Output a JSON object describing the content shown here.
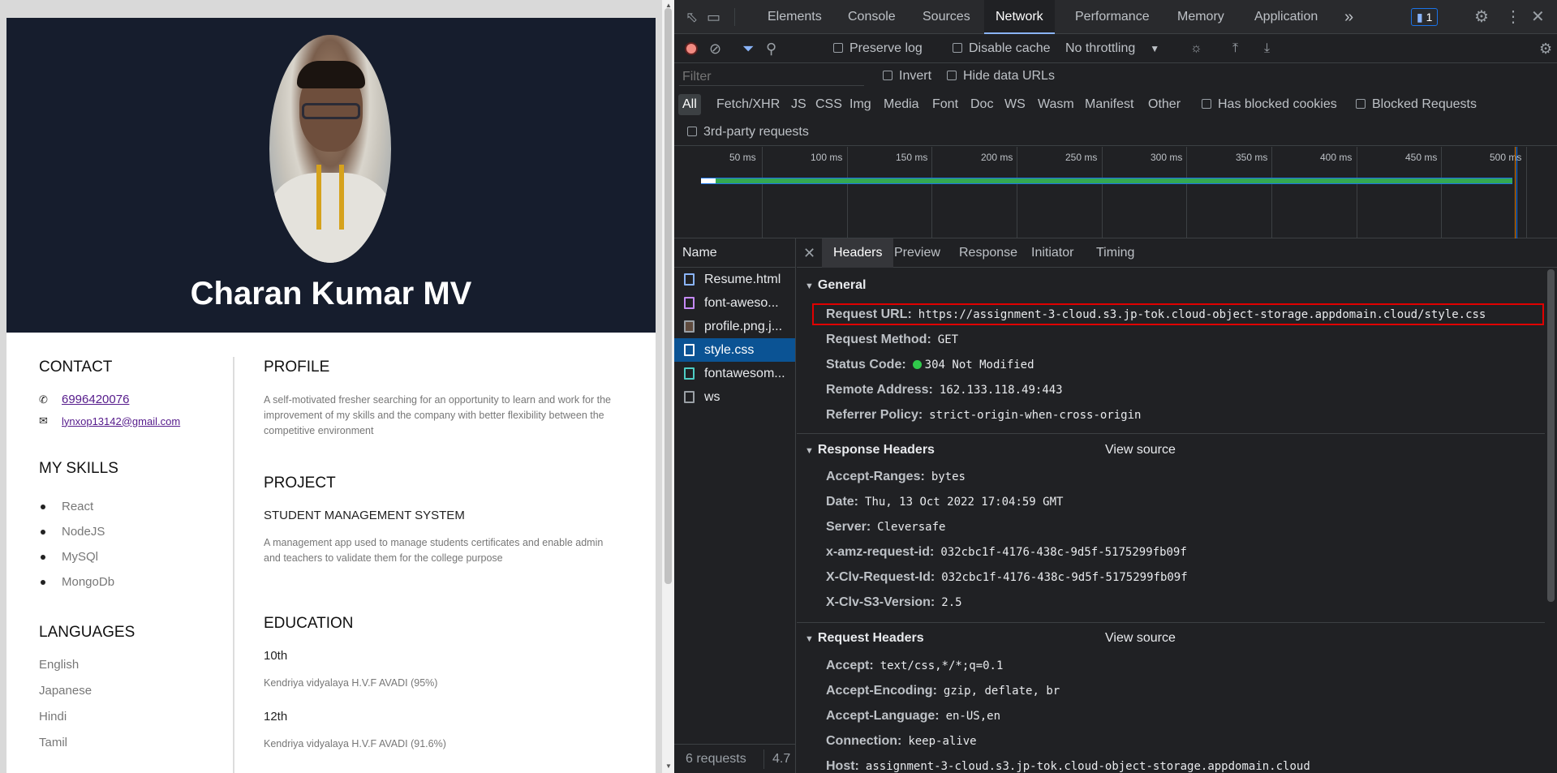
{
  "resume": {
    "name": "Charan Kumar MV",
    "contact": {
      "heading": "CONTACT",
      "phone": "6996420076",
      "email": "lynxop13142@gmail.com"
    },
    "skills": {
      "heading": "MY SKILLS",
      "items": [
        "React",
        "NodeJS",
        "MySQl",
        "MongoDb"
      ]
    },
    "languages": {
      "heading": "LANGUAGES",
      "items": [
        "English",
        "Japanese",
        "Hindi",
        "Tamil"
      ]
    },
    "profile": {
      "heading": "PROFILE",
      "text": "A self-motivated fresher searching for an opportunity to learn and work for the improvement of my skills and the company with better flexibility between the competitive environment"
    },
    "project": {
      "heading": "PROJECT",
      "title": "STUDENT MANAGEMENT SYSTEM",
      "text": "A management app used to manage students certificates and enable admin and teachers to validate them for the college purpose"
    },
    "education": {
      "heading": "EDUCATION",
      "items": [
        {
          "level": "10th",
          "school": "Kendriya vidyalaya H.V.F AVADI (95%)"
        },
        {
          "level": "12th",
          "school": "Kendriya vidyalaya H.V.F AVADI (91.6%)"
        }
      ]
    }
  },
  "devtools": {
    "tabs": [
      "Elements",
      "Console",
      "Sources",
      "Network",
      "Performance",
      "Memory",
      "Application"
    ],
    "active_tab": "Network",
    "more_tabs": "»",
    "issues_count": "1",
    "toolbar": {
      "preserve_log": "Preserve log",
      "disable_cache": "Disable cache",
      "throttling": "No throttling"
    },
    "filter": {
      "placeholder": "Filter",
      "invert": "Invert",
      "hide_data_urls": "Hide data URLs"
    },
    "types": [
      "All",
      "Fetch/XHR",
      "JS",
      "CSS",
      "Img",
      "Media",
      "Font",
      "Doc",
      "WS",
      "Wasm",
      "Manifest",
      "Other"
    ],
    "has_blocked_cookies": "Has blocked cookies",
    "blocked_requests": "Blocked Requests",
    "third_party": "3rd-party requests",
    "timeline_ticks": [
      "50 ms",
      "100 ms",
      "150 ms",
      "200 ms",
      "250 ms",
      "300 ms",
      "350 ms",
      "400 ms",
      "450 ms",
      "500 ms"
    ],
    "name_header": "Name",
    "files": [
      {
        "name": "Resume.html",
        "icon": "document-icon",
        "color": "#8ab4f8"
      },
      {
        "name": "font-aweso...",
        "icon": "stylesheet-icon",
        "color": "#c58af9"
      },
      {
        "name": "profile.png.j...",
        "icon": "image-icon",
        "color": "#9aa0a6"
      },
      {
        "name": "style.css",
        "icon": "stylesheet-icon",
        "color": "#ffffff"
      },
      {
        "name": "fontawesom...",
        "icon": "font-icon",
        "color": "#4ecdc4"
      },
      {
        "name": "ws",
        "icon": "websocket-icon",
        "color": "#9aa0a6"
      }
    ],
    "selected_file": "style.css",
    "footer": {
      "requests": "6 requests",
      "size": "4.7"
    },
    "detail_tabs": [
      "Headers",
      "Preview",
      "Response",
      "Initiator",
      "Timing"
    ],
    "active_detail_tab": "Headers",
    "general": {
      "title": "General",
      "rows": [
        {
          "k": "Request URL:",
          "v": "https://assignment-3-cloud.s3.jp-tok.cloud-object-storage.appdomain.cloud/style.css"
        },
        {
          "k": "Request Method:",
          "v": "GET"
        },
        {
          "k": "Status Code:",
          "v": "304 Not Modified"
        },
        {
          "k": "Remote Address:",
          "v": "162.133.118.49:443"
        },
        {
          "k": "Referrer Policy:",
          "v": "strict-origin-when-cross-origin"
        }
      ]
    },
    "response_headers": {
      "title": "Response Headers",
      "view_source": "View source",
      "rows": [
        {
          "k": "Accept-Ranges:",
          "v": "bytes"
        },
        {
          "k": "Date:",
          "v": "Thu, 13 Oct 2022 17:04:59 GMT"
        },
        {
          "k": "Server:",
          "v": "Cleversafe"
        },
        {
          "k": "x-amz-request-id:",
          "v": "032cbc1f-4176-438c-9d5f-5175299fb09f"
        },
        {
          "k": "X-Clv-Request-Id:",
          "v": "032cbc1f-4176-438c-9d5f-5175299fb09f"
        },
        {
          "k": "X-Clv-S3-Version:",
          "v": "2.5"
        }
      ]
    },
    "request_headers": {
      "title": "Request Headers",
      "view_source": "View source",
      "rows": [
        {
          "k": "Accept:",
          "v": "text/css,*/*;q=0.1"
        },
        {
          "k": "Accept-Encoding:",
          "v": "gzip, deflate, br"
        },
        {
          "k": "Accept-Language:",
          "v": "en-US,en"
        },
        {
          "k": "Connection:",
          "v": "keep-alive"
        },
        {
          "k": "Host:",
          "v": "assignment-3-cloud.s3.jp-tok.cloud-object-storage.appdomain.cloud"
        }
      ]
    },
    "colors": {
      "accent": "#8ab4f8",
      "selected_row": "#0b5394",
      "status_ok": "#30c94b",
      "highlight": "#e00000"
    }
  }
}
